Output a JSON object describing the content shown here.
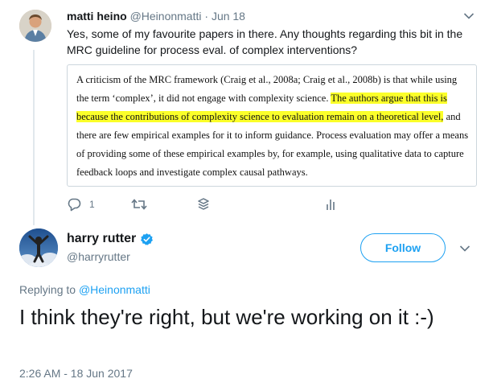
{
  "tweet1": {
    "author_name": "matti heino",
    "author_handle": "@Heinonmatti",
    "separator": "·",
    "date": "Jun 18",
    "text": "Yes, some of my favourite papers in there. Any thoughts regarding this bit in the MRC guideline for process eval. of complex interventions?",
    "quote": {
      "before": "A criticism of the MRC framework (Craig et al., 2008a; Craig et al., 2008b) is that while using the term ‘complex’, it did not engage with complexity science. ",
      "highlighted": "The authors argue that this is because the contributions of complexity science to evaluation remain on a theoretical level,",
      "after": " and there are few empirical examples for it to inform guidance. Process evaluation may offer a means of providing some of these empirical examples by, for example, using qualitative data to capture feedback loops and investigate complex causal pathways.",
      "highlight_color": "#fbff2a"
    },
    "actions": {
      "reply_count": "1"
    },
    "icons": [
      "reply-icon",
      "retweet-icon",
      "layers-icon",
      "analytics-icon",
      "chevron-down-icon"
    ]
  },
  "tweet2": {
    "author_name": "harry rutter",
    "author_handle": "@harryrutter",
    "follow_label": "Follow",
    "replying_prefix": "Replying to",
    "replying_handle": "@Heinonmatti",
    "text": "I think they're right, but we're working on it :-)",
    "timestamp": "2:26 AM - 18 Jun 2017",
    "icons": [
      "verified-badge-icon",
      "chevron-down-icon"
    ]
  },
  "colors": {
    "link": "#1da1f2",
    "secondary_text": "#657786",
    "primary_text": "#14171a",
    "border": "#ccd6dd"
  }
}
